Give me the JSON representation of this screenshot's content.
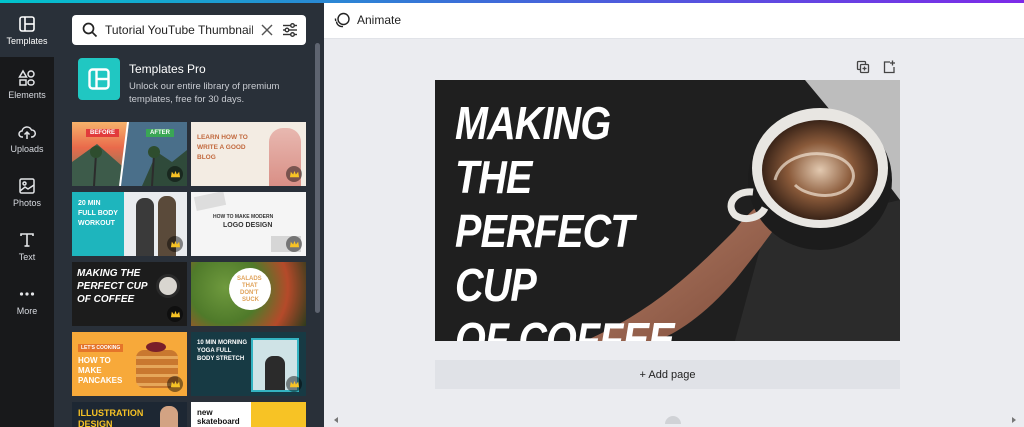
{
  "rail": {
    "items": [
      {
        "label": "Templates",
        "icon": "templates-icon",
        "active": true
      },
      {
        "label": "Elements",
        "icon": "elements-icon"
      },
      {
        "label": "Uploads",
        "icon": "upload-cloud-icon"
      },
      {
        "label": "Photos",
        "icon": "image-icon"
      },
      {
        "label": "Text",
        "icon": "text-t-icon"
      },
      {
        "label": "More",
        "icon": "more-dots-icon"
      }
    ]
  },
  "search": {
    "value": "Tutorial YouTube Thumbnail",
    "placeholder": ""
  },
  "pro": {
    "title": "Templates Pro",
    "description": "Unlock our entire library of premium templates, free for 30 days."
  },
  "thumbnails": {
    "before_after": {
      "before": "BEFORE",
      "after": "AFTER"
    },
    "blog": {
      "line1": "LEARN HOW TO",
      "line2": "WRITE A GOOD",
      "line3": "BLOG"
    },
    "workout": {
      "line1": "20 MIN",
      "line2": "FULL BODY",
      "line3": "WORKOUT"
    },
    "logo": {
      "line1": "HOW TO MAKE MODERN",
      "line2": "LOGO DESIGN"
    },
    "coffee": {
      "line1": "MAKING THE",
      "line2": "PERFECT CUP",
      "line3": "OF COFFEE"
    },
    "salads": {
      "line1": "SALADS",
      "line2": "THAT",
      "line3": "DON'T",
      "line4": "SUCK"
    },
    "pancakes": {
      "tag": "LET'S COOKING",
      "line1": "HOW TO",
      "line2": "MAKE",
      "line3": "PANCAKES"
    },
    "yoga": {
      "line1": "10 MIN MORNING",
      "line2": "YOGA FULL",
      "line3": "BODY STRETCH"
    },
    "illustration": {
      "line1": "ILLUSTRATION",
      "line2": "DESIGN"
    },
    "skate": {
      "line1": "new",
      "line2": "skateboard"
    }
  },
  "header": {
    "animate_label": "Animate"
  },
  "design": {
    "line1": "MAKING THE",
    "line2": "PERFECT CUP",
    "line3": "OF COFFEE"
  },
  "canvas": {
    "add_page_label": "+ Add page"
  },
  "colors": {
    "rail_bg": "#18191b",
    "panel_bg": "#293039",
    "accent_teal": "#20c7c2",
    "workspace_bg": "#ebecf0"
  }
}
